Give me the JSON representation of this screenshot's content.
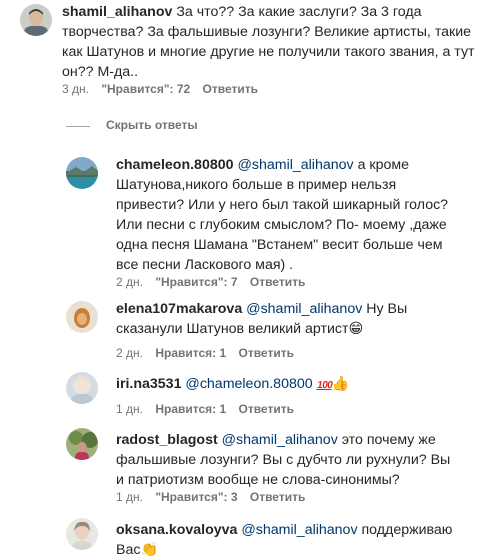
{
  "comments_root": {
    "username": "shamil_alihanov",
    "text": "За что?? За какие заслуги? За 3 года творчества? За фальшивые лозунги? Великие артисты, такие как Шатунов и многие другие не получили такого звания, а тут он?? М-да..",
    "time": "3 дн.",
    "likes": "\"Нравится\": 72",
    "reply": "Ответить"
  },
  "hide_replies": "Скрыть ответы",
  "replies": [
    {
      "username": "chameleon.80800",
      "mention": "@shamil_alihanov",
      "text": "а кроме Шатунова,никого больше в пример нельзя привести? Или у него был такой шикарный голос? Или песни с глубоким смыслом? По- моему ,даже одна песня Шамана \"Встанем\" весит больше чем все песни Ласкового мая) .",
      "time": "2 дн.",
      "likes": "\"Нравится\": 7",
      "reply": "Ответить"
    },
    {
      "username": "elena107makarova",
      "mention": "@shamil_alihanov",
      "text": "Ну Вы сказанули Шатунов великий артист",
      "emoji": "😁",
      "time": "2 дн.",
      "likes": "Нравится: 1",
      "reply": "Ответить"
    },
    {
      "username": "iri.na3531",
      "mention": "@chameleon.80800",
      "text": "",
      "emoji_100": "100",
      "emoji": "👍",
      "time": "1 дн.",
      "likes": "Нравится: 1",
      "reply": "Ответить"
    },
    {
      "username": "radost_blagost",
      "mention": "@shamil_alihanov",
      "text": "это почему же фальшивые лозунги? Вы с дубчто ли рухнули? Вы и патриотизм вообще не слова-синонимы?",
      "time": "1 дн.",
      "likes": "\"Нравится\": 3",
      "reply": "Ответить"
    },
    {
      "username": "oksana.kovaloyva",
      "mention": "@shamil_alihanov",
      "text": "поддерживаю Вас",
      "emoji": "👏",
      "time": "",
      "likes": "",
      "reply": ""
    }
  ],
  "colors": {
    "text": "#262626",
    "meta": "#737373",
    "mention": "#00376b"
  }
}
